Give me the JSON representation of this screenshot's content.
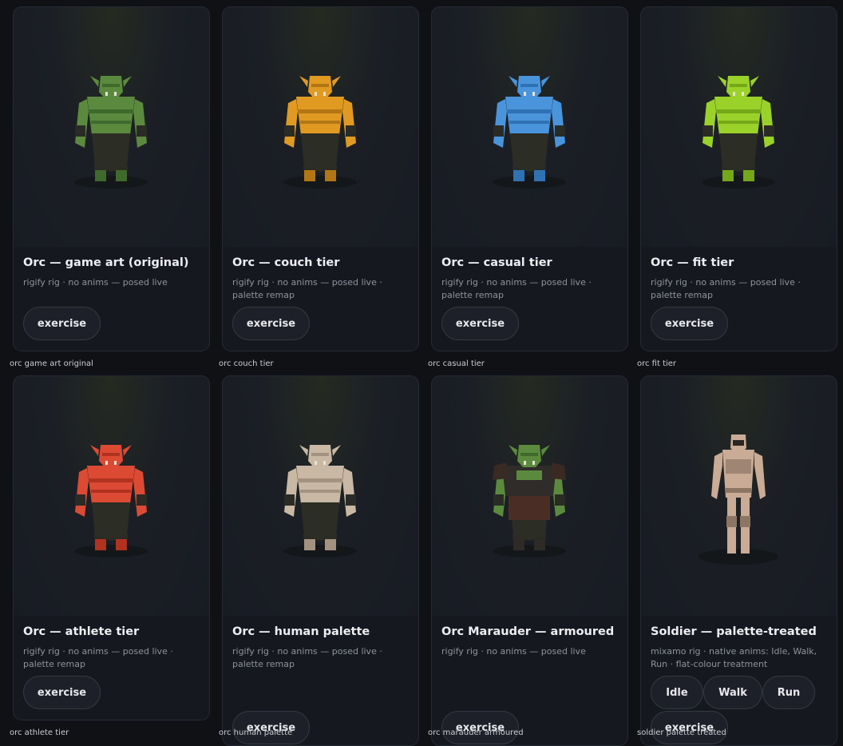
{
  "cards": [
    {
      "title": "Orc — game art (original)",
      "desc": "rigify rig · no anims — posed live",
      "caption": "orc game art original",
      "skin": "#5b8a3e",
      "skin_dark": "#3f6a2c",
      "buttons": [
        "exercise"
      ]
    },
    {
      "title": "Orc — couch tier",
      "desc": "rigify rig · no anims — posed live · palette remap",
      "caption": "orc couch tier",
      "skin": "#e09a22",
      "skin_dark": "#b27614",
      "buttons": [
        "exercise"
      ]
    },
    {
      "title": "Orc — casual tier",
      "desc": "rigify rig · no anims — posed live · palette remap",
      "caption": "orc casual tier",
      "skin": "#4a94dc",
      "skin_dark": "#2f72b4",
      "buttons": [
        "exercise"
      ]
    },
    {
      "title": "Orc — fit tier",
      "desc": "rigify rig · no anims — posed live · palette remap",
      "caption": "orc fit tier",
      "skin": "#9ad22a",
      "skin_dark": "#74a818",
      "buttons": [
        "exercise"
      ]
    },
    {
      "title": "Orc — athlete tier",
      "desc": "rigify rig · no anims — posed live · palette remap",
      "caption": "orc athlete tier",
      "skin": "#dc4a34",
      "skin_dark": "#b0321f",
      "buttons": [
        "exercise"
      ]
    },
    {
      "title": "Orc — human palette",
      "desc": "rigify rig · no anims — posed live · palette remap",
      "caption": "orc human palette",
      "skin": "#c8b8a4",
      "skin_dark": "#a39280",
      "buttons": [
        "exercise"
      ]
    },
    {
      "title": "Orc Marauder — armoured",
      "desc": "rigify rig · no anims — posed live",
      "caption": "orc marauder armoured",
      "skin": "#5b8a3e",
      "skin_dark": "#3f6a2c",
      "buttons": [
        "exercise"
      ]
    },
    {
      "title": "Soldier — palette-treated",
      "desc": "mixamo rig · native anims: Idle, Walk, Run · flat-colour treatment",
      "caption": "soldier palette treated",
      "skin": "#c9ab96",
      "skin_dark": "#8d7564",
      "buttons": [
        "Idle",
        "Walk",
        "Run",
        "exercise"
      ]
    }
  ]
}
